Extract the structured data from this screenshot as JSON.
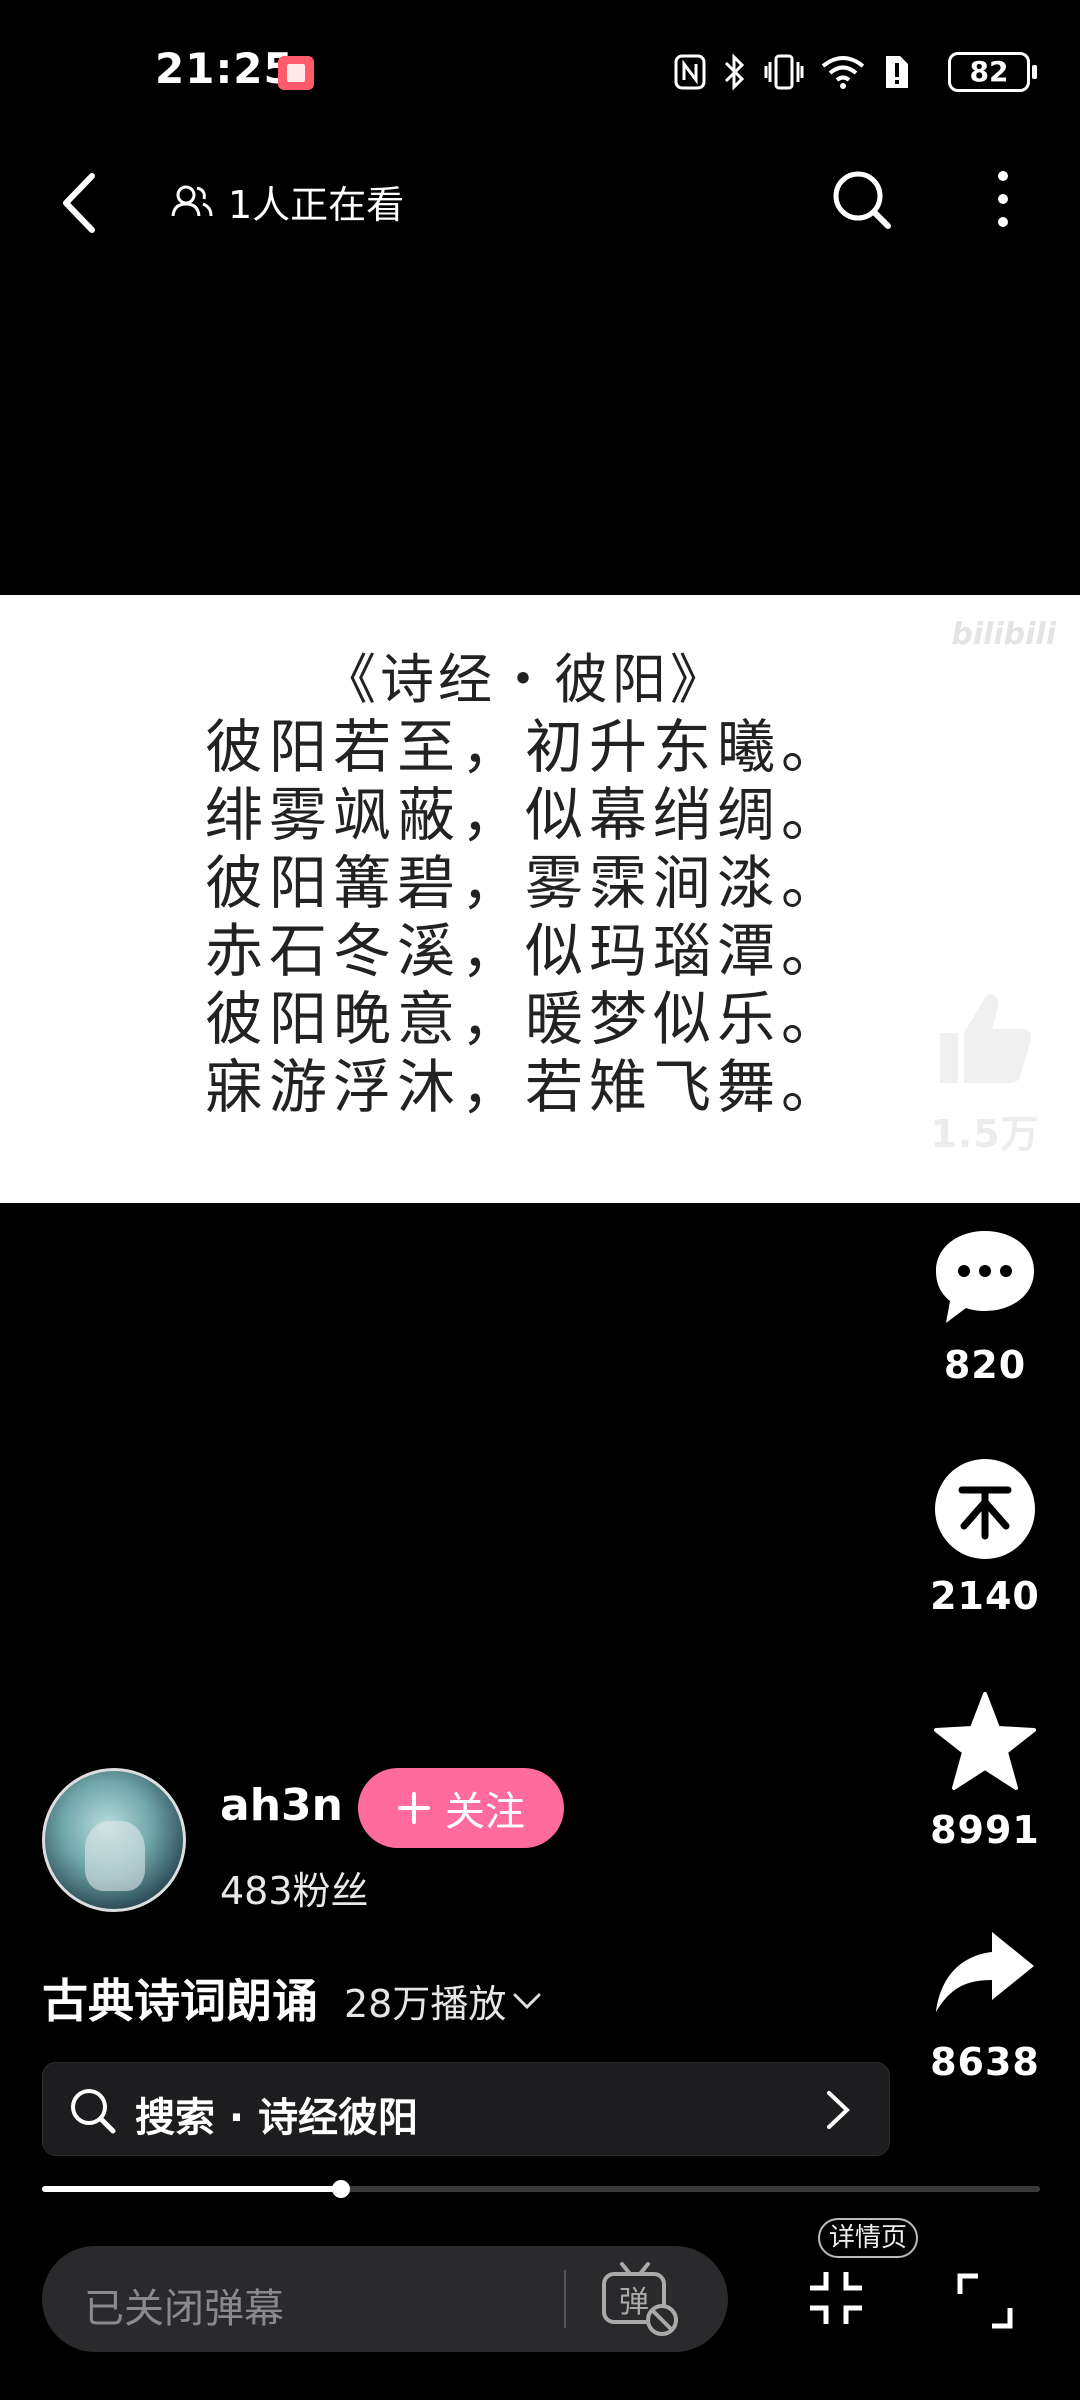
{
  "status_bar": {
    "time": "21:25",
    "battery": "82"
  },
  "top_bar": {
    "watching_text": "1人正在看"
  },
  "video": {
    "watermark": "bilibili",
    "poem_title": "《诗经・彼阳》",
    "poem_lines": [
      "彼阳若至，初升东曦。",
      "绯雾飒蔽，似幕绡绸。",
      "彼阳篝碧，雾霂涧渁。",
      "赤石冬溪，似玛瑙潭。",
      "彼阳晚意，暖梦似乐。",
      "寐游浮沐，若雉飞舞。"
    ]
  },
  "actions": {
    "like_count": "1.5万",
    "comment_count": "820",
    "coin_count": "2140",
    "favorite_count": "8991",
    "share_count": "8638"
  },
  "author": {
    "name": "ah3n",
    "follow_label": "关注",
    "fans": "483粉丝"
  },
  "collection": {
    "title": "古典诗词朗诵",
    "plays": "28万播放"
  },
  "search": {
    "text": "搜索 · 诗经彼阳"
  },
  "progress": {
    "fraction": 0.3
  },
  "bottom": {
    "danmaku_placeholder": "已关闭弹幕",
    "detail_label": "详情页"
  },
  "colors": {
    "follow": "#ff6b9d",
    "background": "#000000"
  }
}
